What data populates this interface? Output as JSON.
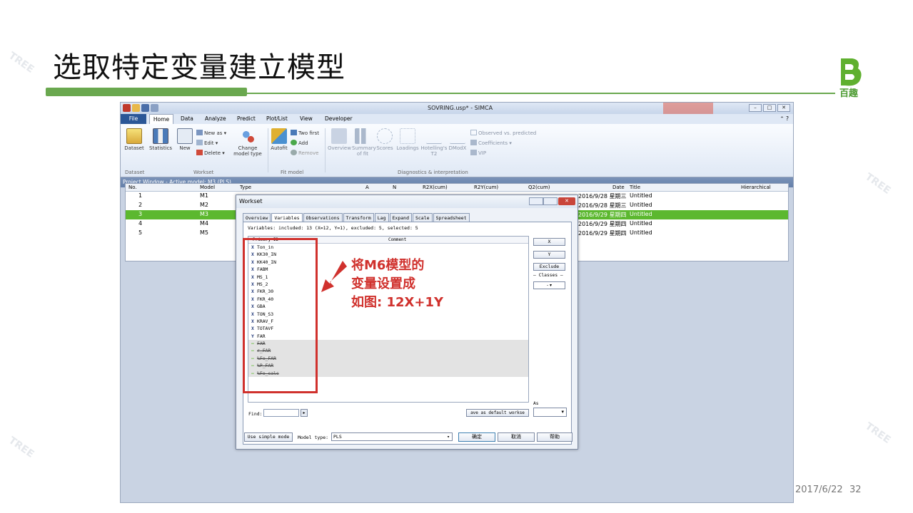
{
  "slide": {
    "title": "选取特定变量建立模型",
    "logo_text": "百趣",
    "date": "2017/6/22",
    "page": "32"
  },
  "app": {
    "window_title": "SOVRING.usp* - SIMCA",
    "ribbon_tabs": [
      "File",
      "Home",
      "Data",
      "Analyze",
      "Predict",
      "Plot/List",
      "View",
      "Developer"
    ],
    "ribbon_buttons": {
      "dataset": "Dataset",
      "statistics": "Statistics",
      "new": "New",
      "new_as": "New as",
      "edit": "Edit",
      "delete": "Delete",
      "change_model_type": "Change model type",
      "autofit": "Autofit",
      "two_first": "Two first",
      "add": "Add",
      "remove": "Remove",
      "overview": "Overview",
      "summary_of_fit": "Summary of fit",
      "scores": "Scores",
      "loadings": "Loadings",
      "hotellings_t2": "Hotelling's T2",
      "dmodx": "DModX",
      "observed_vs_predicted": "Observed vs. predicted",
      "coefficients": "Coefficients",
      "vip": "VIP"
    },
    "ribbon_groups": {
      "dataset": "Dataset",
      "workset": "Workset",
      "fit_model": "Fit model",
      "diagnostics": "Diagnostics & interpretation"
    },
    "project_window_title": "Project Window - Active model: M3 (PLS)",
    "columns": [
      "No.",
      "Model",
      "Type",
      "A",
      "N",
      "R2X(cum)",
      "R2Y(cum)",
      "Q2(cum)",
      "Date",
      "Title",
      "Hierarchical"
    ],
    "rows": [
      {
        "no": "1",
        "model": "M1",
        "date": "2016/9/28 星期三",
        "title": "Untitled"
      },
      {
        "no": "2",
        "model": "M2",
        "date": "2016/9/28 星期三",
        "title": "Untitled"
      },
      {
        "no": "3",
        "model": "M3",
        "date": "2016/9/29 星期四",
        "title": "Untitled"
      },
      {
        "no": "4",
        "model": "M4",
        "date": "2016/9/29 星期四",
        "title": "Untitled"
      },
      {
        "no": "5",
        "model": "M5",
        "date": "2016/9/29 星期四",
        "title": "Untitled"
      }
    ],
    "selected_row": 3
  },
  "dialog": {
    "title": "Workset",
    "tabs": [
      "Overview",
      "Variables",
      "Observations",
      "Transform",
      "Lag",
      "Expand",
      "Scale",
      "Spreadsheet"
    ],
    "active_tab": "Variables",
    "info": "Variables: included: 13 (X=12, Y=1), excluded: 5, selected: 5",
    "list_header_id": "Primary ID",
    "list_header_comment": "Comment",
    "variables": [
      {
        "mark": "X",
        "name": "Ton_in",
        "excluded": false
      },
      {
        "mark": "X",
        "name": "KK30_IN",
        "excluded": false
      },
      {
        "mark": "X",
        "name": "KK40_IN",
        "excluded": false
      },
      {
        "mark": "X",
        "name": "FABM",
        "excluded": false
      },
      {
        "mark": "X",
        "name": "MS_1",
        "excluded": false
      },
      {
        "mark": "X",
        "name": "MS_2",
        "excluded": false
      },
      {
        "mark": "X",
        "name": "FKR_30",
        "excluded": false
      },
      {
        "mark": "X",
        "name": "FKR_40",
        "excluded": false
      },
      {
        "mark": "X",
        "name": "GBA",
        "excluded": false
      },
      {
        "mark": "X",
        "name": "TON_S3",
        "excluded": false
      },
      {
        "mark": "X",
        "name": "KRAV_F",
        "excluded": false
      },
      {
        "mark": "X",
        "name": "TOTAVF",
        "excluded": false
      },
      {
        "mark": "Y",
        "name": "FAR",
        "excluded": false
      },
      {
        "mark": "—",
        "name": "FAR",
        "excluded": true
      },
      {
        "mark": "—",
        "name": "r_FAR",
        "excluded": true
      },
      {
        "mark": "—",
        "name": "%Fe_FAR",
        "excluded": true
      },
      {
        "mark": "—",
        "name": "%P_FAR",
        "excluded": true
      },
      {
        "mark": "—",
        "name": "%Fe_calc",
        "excluded": true
      }
    ],
    "side_buttons": [
      "X",
      "Y",
      "Exclude"
    ],
    "classes_label": "Classes",
    "classes_value": "-",
    "find_label": "Find:",
    "save_default": "ave as default workse",
    "as_label": "As",
    "use_simple_mode": "Use simple mode",
    "model_type_label": "Model type:",
    "model_type_value": "PLS",
    "ok": "确定",
    "cancel": "取消",
    "help": "帮助"
  },
  "annotation": {
    "line1": "将M6模型的",
    "line2": "变量设置成",
    "line3": "如图: 12X+1Y"
  },
  "colors": {
    "accent_green": "#6aa84f",
    "selection_green": "#5cb82f",
    "highlight_red": "#d0312d"
  }
}
